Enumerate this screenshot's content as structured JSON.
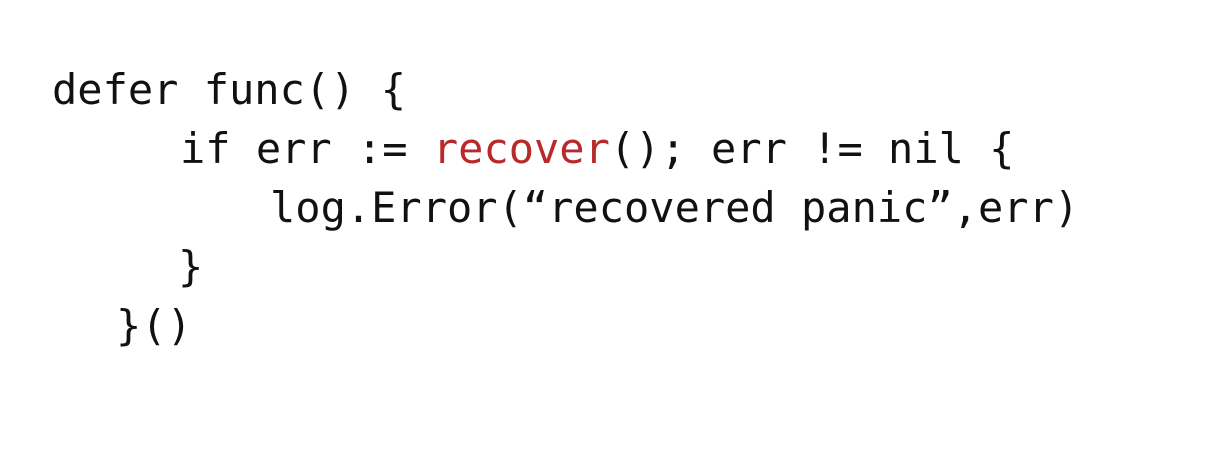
{
  "code": {
    "line1": "defer func() {",
    "line2_before": "if err := ",
    "line2_highlight": "recover",
    "line2_after": "(); err != nil {",
    "line3": "log.Error(“recovered panic”,err)",
    "line4": "}",
    "line5": "}()"
  },
  "colors": {
    "text": "#111111",
    "highlight": "#b8292a",
    "background": "#ffffff"
  }
}
